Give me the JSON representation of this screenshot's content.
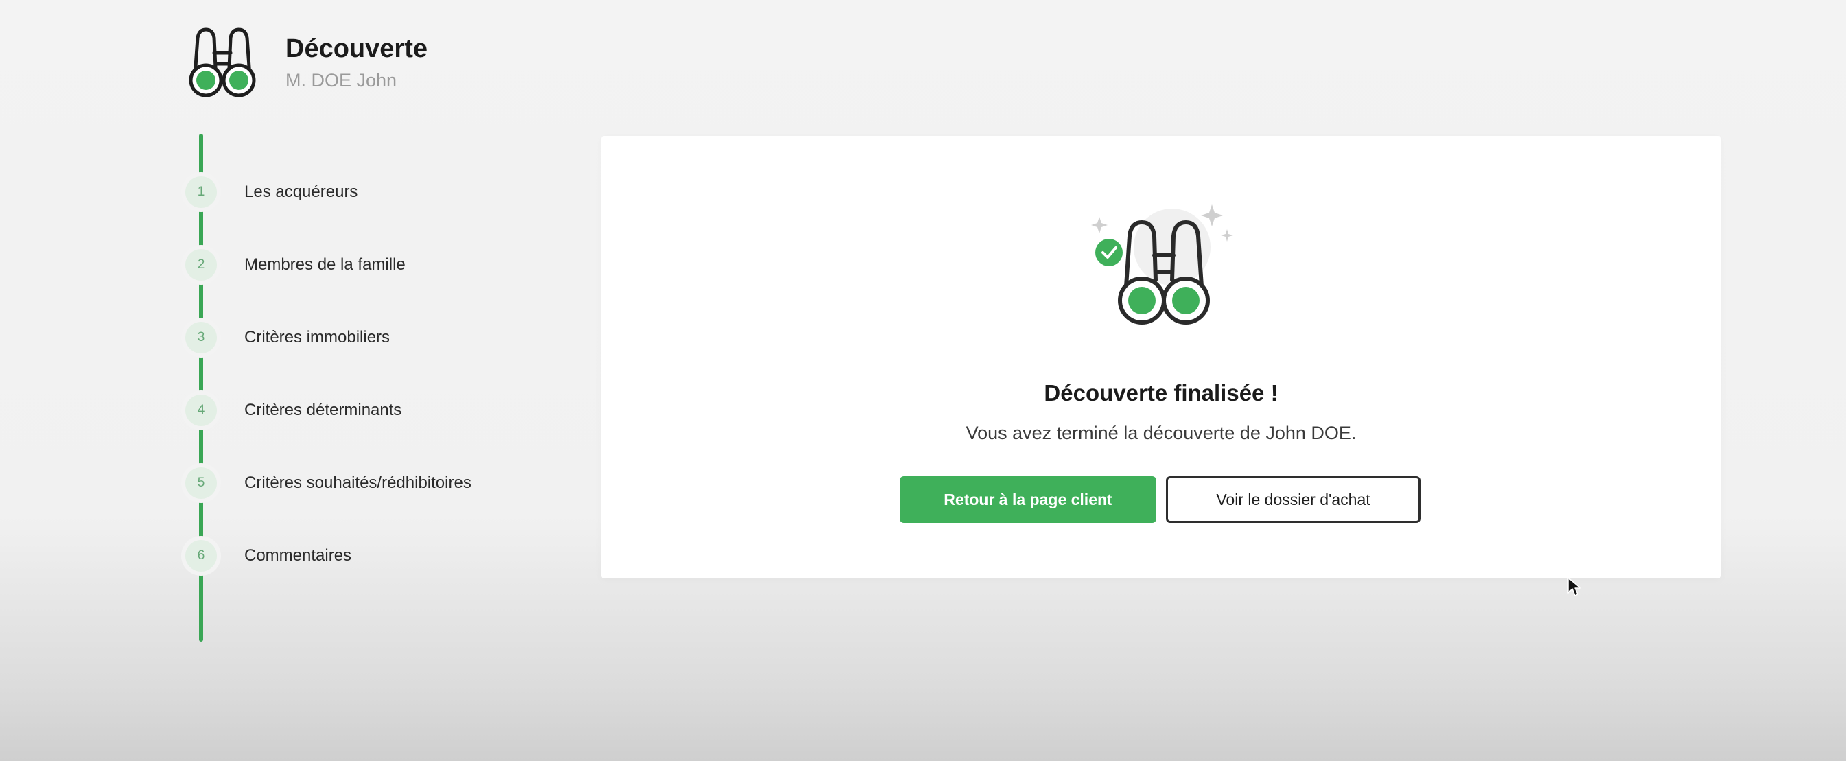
{
  "header": {
    "title": "Découverte",
    "subtitle": "M. DOE John",
    "logo_icon": "binoculars-icon"
  },
  "steps": [
    {
      "number": "1",
      "label": "Les acquéreurs"
    },
    {
      "number": "2",
      "label": "Membres de la famille"
    },
    {
      "number": "3",
      "label": "Critères immobiliers"
    },
    {
      "number": "4",
      "label": "Critères déterminants"
    },
    {
      "number": "5",
      "label": "Critères souhaités/rédhibitoires"
    },
    {
      "number": "6",
      "label": "Commentaires"
    }
  ],
  "card": {
    "illustration_icon": "binoculars-check-icon",
    "title": "Découverte finalisée !",
    "message": "Vous avez terminé la découverte de John DOE.",
    "primary_button": "Retour à la page client",
    "secondary_button": "Voir le dossier d'achat"
  },
  "colors": {
    "accent_green": "#3fb05a",
    "stepper_line": "#3aa655",
    "text_dark": "#1b1b1b",
    "text_muted": "#9a9a9a"
  }
}
